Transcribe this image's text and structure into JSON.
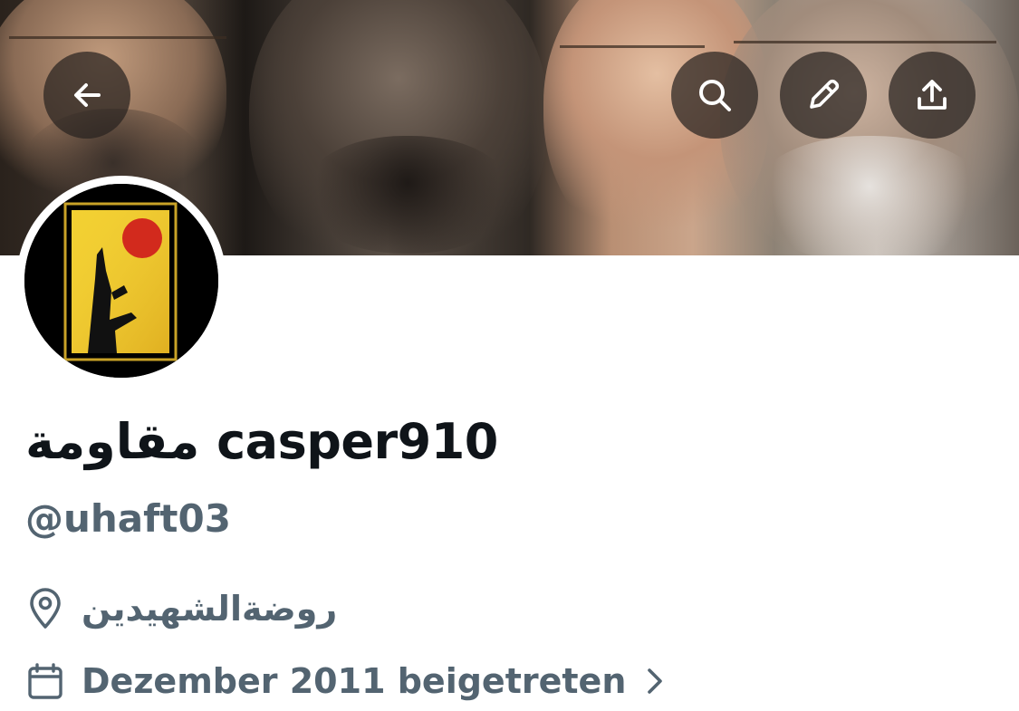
{
  "header": {
    "back_icon": "arrow-left-icon",
    "search_icon": "search-icon",
    "edit_icon": "pencil-icon",
    "share_icon": "share-upload-icon"
  },
  "profile": {
    "display_name": "مقاومة casper910",
    "handle": "@uhaft03",
    "location": "روضةالشهيدين",
    "joined": "Dezember 2011 beigetreten"
  },
  "colors": {
    "name": "#0f1419",
    "secondary": "#536471",
    "button_bg": "rgba(40,34,32,0.72)"
  }
}
